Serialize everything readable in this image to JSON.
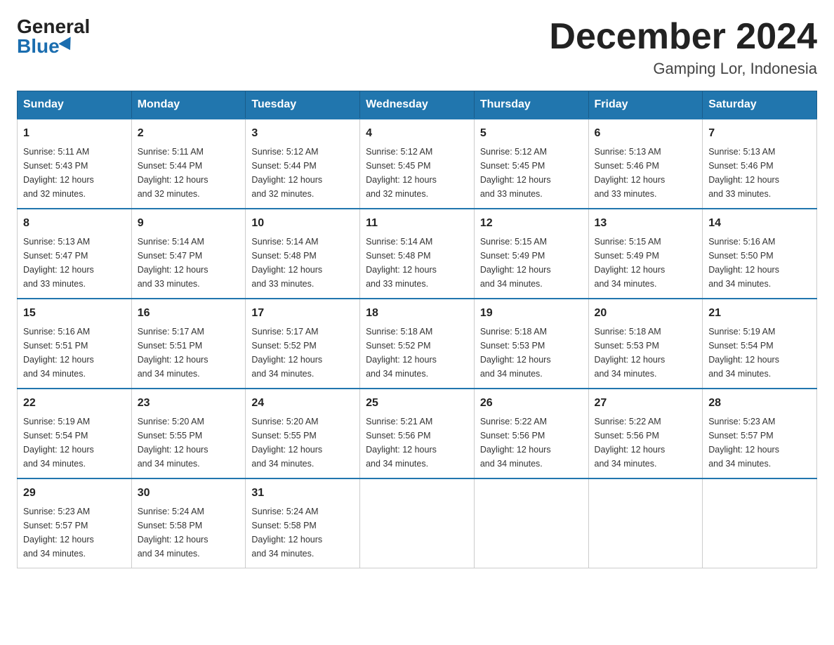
{
  "logo": {
    "general": "General",
    "blue": "Blue"
  },
  "header": {
    "month": "December 2024",
    "location": "Gamping Lor, Indonesia"
  },
  "weekdays": [
    "Sunday",
    "Monday",
    "Tuesday",
    "Wednesday",
    "Thursday",
    "Friday",
    "Saturday"
  ],
  "weeks": [
    [
      {
        "day": "1",
        "sunrise": "5:11 AM",
        "sunset": "5:43 PM",
        "daylight": "12 hours and 32 minutes."
      },
      {
        "day": "2",
        "sunrise": "5:11 AM",
        "sunset": "5:44 PM",
        "daylight": "12 hours and 32 minutes."
      },
      {
        "day": "3",
        "sunrise": "5:12 AM",
        "sunset": "5:44 PM",
        "daylight": "12 hours and 32 minutes."
      },
      {
        "day": "4",
        "sunrise": "5:12 AM",
        "sunset": "5:45 PM",
        "daylight": "12 hours and 32 minutes."
      },
      {
        "day": "5",
        "sunrise": "5:12 AM",
        "sunset": "5:45 PM",
        "daylight": "12 hours and 33 minutes."
      },
      {
        "day": "6",
        "sunrise": "5:13 AM",
        "sunset": "5:46 PM",
        "daylight": "12 hours and 33 minutes."
      },
      {
        "day": "7",
        "sunrise": "5:13 AM",
        "sunset": "5:46 PM",
        "daylight": "12 hours and 33 minutes."
      }
    ],
    [
      {
        "day": "8",
        "sunrise": "5:13 AM",
        "sunset": "5:47 PM",
        "daylight": "12 hours and 33 minutes."
      },
      {
        "day": "9",
        "sunrise": "5:14 AM",
        "sunset": "5:47 PM",
        "daylight": "12 hours and 33 minutes."
      },
      {
        "day": "10",
        "sunrise": "5:14 AM",
        "sunset": "5:48 PM",
        "daylight": "12 hours and 33 minutes."
      },
      {
        "day": "11",
        "sunrise": "5:14 AM",
        "sunset": "5:48 PM",
        "daylight": "12 hours and 33 minutes."
      },
      {
        "day": "12",
        "sunrise": "5:15 AM",
        "sunset": "5:49 PM",
        "daylight": "12 hours and 34 minutes."
      },
      {
        "day": "13",
        "sunrise": "5:15 AM",
        "sunset": "5:49 PM",
        "daylight": "12 hours and 34 minutes."
      },
      {
        "day": "14",
        "sunrise": "5:16 AM",
        "sunset": "5:50 PM",
        "daylight": "12 hours and 34 minutes."
      }
    ],
    [
      {
        "day": "15",
        "sunrise": "5:16 AM",
        "sunset": "5:51 PM",
        "daylight": "12 hours and 34 minutes."
      },
      {
        "day": "16",
        "sunrise": "5:17 AM",
        "sunset": "5:51 PM",
        "daylight": "12 hours and 34 minutes."
      },
      {
        "day": "17",
        "sunrise": "5:17 AM",
        "sunset": "5:52 PM",
        "daylight": "12 hours and 34 minutes."
      },
      {
        "day": "18",
        "sunrise": "5:18 AM",
        "sunset": "5:52 PM",
        "daylight": "12 hours and 34 minutes."
      },
      {
        "day": "19",
        "sunrise": "5:18 AM",
        "sunset": "5:53 PM",
        "daylight": "12 hours and 34 minutes."
      },
      {
        "day": "20",
        "sunrise": "5:18 AM",
        "sunset": "5:53 PM",
        "daylight": "12 hours and 34 minutes."
      },
      {
        "day": "21",
        "sunrise": "5:19 AM",
        "sunset": "5:54 PM",
        "daylight": "12 hours and 34 minutes."
      }
    ],
    [
      {
        "day": "22",
        "sunrise": "5:19 AM",
        "sunset": "5:54 PM",
        "daylight": "12 hours and 34 minutes."
      },
      {
        "day": "23",
        "sunrise": "5:20 AM",
        "sunset": "5:55 PM",
        "daylight": "12 hours and 34 minutes."
      },
      {
        "day": "24",
        "sunrise": "5:20 AM",
        "sunset": "5:55 PM",
        "daylight": "12 hours and 34 minutes."
      },
      {
        "day": "25",
        "sunrise": "5:21 AM",
        "sunset": "5:56 PM",
        "daylight": "12 hours and 34 minutes."
      },
      {
        "day": "26",
        "sunrise": "5:22 AM",
        "sunset": "5:56 PM",
        "daylight": "12 hours and 34 minutes."
      },
      {
        "day": "27",
        "sunrise": "5:22 AM",
        "sunset": "5:56 PM",
        "daylight": "12 hours and 34 minutes."
      },
      {
        "day": "28",
        "sunrise": "5:23 AM",
        "sunset": "5:57 PM",
        "daylight": "12 hours and 34 minutes."
      }
    ],
    [
      {
        "day": "29",
        "sunrise": "5:23 AM",
        "sunset": "5:57 PM",
        "daylight": "12 hours and 34 minutes."
      },
      {
        "day": "30",
        "sunrise": "5:24 AM",
        "sunset": "5:58 PM",
        "daylight": "12 hours and 34 minutes."
      },
      {
        "day": "31",
        "sunrise": "5:24 AM",
        "sunset": "5:58 PM",
        "daylight": "12 hours and 34 minutes."
      },
      null,
      null,
      null,
      null
    ]
  ],
  "labels": {
    "sunrise": "Sunrise:",
    "sunset": "Sunset:",
    "daylight": "Daylight:"
  }
}
